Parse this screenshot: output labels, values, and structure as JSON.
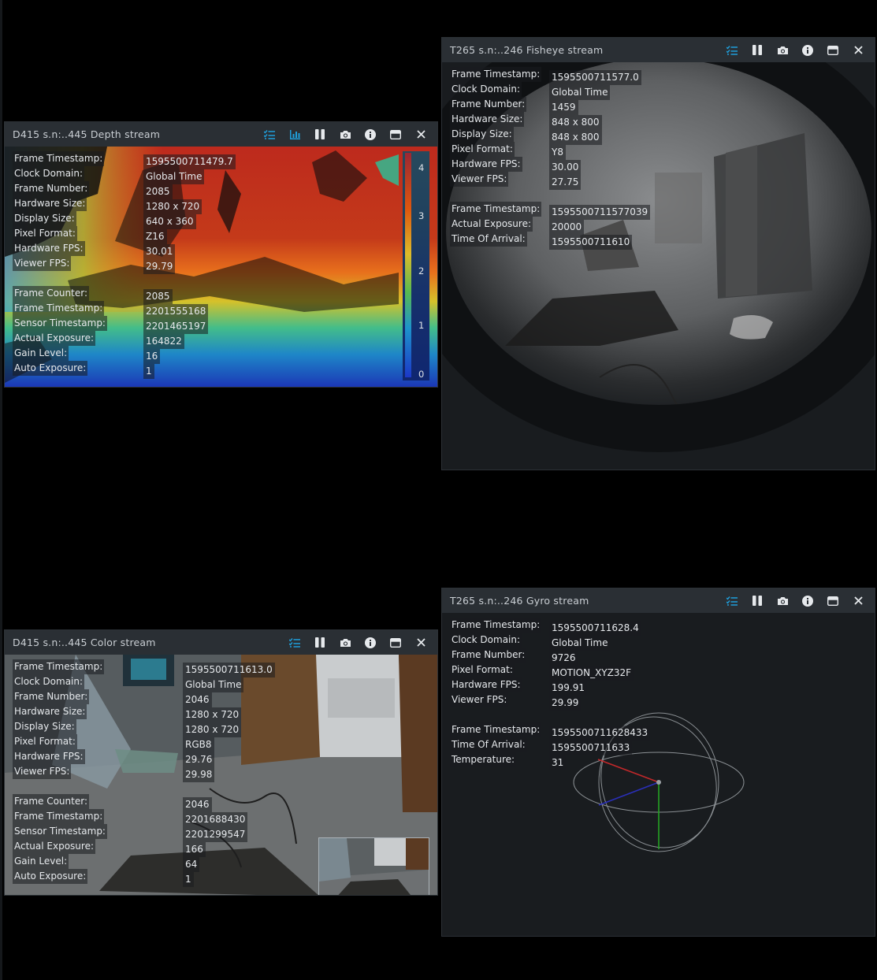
{
  "accent_color": "#1f9fdb",
  "depth": {
    "title": "D415 s.n:..445 Depth stream",
    "rows": [
      {
        "label": "Frame Timestamp:",
        "value": "1595500711479.7"
      },
      {
        "label": "Clock Domain:",
        "value": "Global Time"
      },
      {
        "label": "Frame Number:",
        "value": "2085"
      },
      {
        "label": "Hardware Size:",
        "value": "1280 x 720"
      },
      {
        "label": "Display Size:",
        "value": "640 x 360"
      },
      {
        "label": "Pixel Format:",
        "value": "Z16"
      },
      {
        "label": "Hardware FPS:",
        "value": "30.01"
      },
      {
        "label": "Viewer FPS:",
        "value": "29.79"
      }
    ],
    "rows2": [
      {
        "label": "Frame Counter:",
        "value": "2085"
      },
      {
        "label": "Frame Timestamp:",
        "value": "2201555168"
      },
      {
        "label": "Sensor Timestamp:",
        "value": "2201465197"
      },
      {
        "label": "Actual Exposure:",
        "value": "164822"
      },
      {
        "label": "Gain Level:",
        "value": "16"
      },
      {
        "label": "Auto Exposure:",
        "value": "1"
      }
    ],
    "scale_ticks": [
      "4",
      "3",
      "2",
      "1",
      "0"
    ]
  },
  "fisheye": {
    "title": "T265 s.n:..246 Fisheye stream",
    "rows": [
      {
        "label": "Frame Timestamp:",
        "value": "1595500711577.0"
      },
      {
        "label": "Clock Domain:",
        "value": "Global Time"
      },
      {
        "label": "Frame Number:",
        "value": "1459"
      },
      {
        "label": "Hardware Size:",
        "value": "848 x 800"
      },
      {
        "label": "Display Size:",
        "value": "848 x 800"
      },
      {
        "label": "Pixel Format:",
        "value": "Y8"
      },
      {
        "label": "Hardware FPS:",
        "value": "30.00"
      },
      {
        "label": "Viewer FPS:",
        "value": "27.75"
      }
    ],
    "rows2": [
      {
        "label": "Frame Timestamp:",
        "value": "1595500711577039"
      },
      {
        "label": "Actual Exposure:",
        "value": "20000"
      },
      {
        "label": "Time Of Arrival:",
        "value": "1595500711610"
      }
    ]
  },
  "color": {
    "title": "D415 s.n:..445 Color stream",
    "rows": [
      {
        "label": "Frame Timestamp:",
        "value": "1595500711613.0"
      },
      {
        "label": "Clock Domain:",
        "value": "Global Time"
      },
      {
        "label": "Frame Number:",
        "value": "2046"
      },
      {
        "label": "Hardware Size:",
        "value": "1280 x 720"
      },
      {
        "label": "Display Size:",
        "value": "1280 x 720"
      },
      {
        "label": "Pixel Format:",
        "value": "RGB8"
      },
      {
        "label": "Hardware FPS:",
        "value": "29.76"
      },
      {
        "label": "Viewer FPS:",
        "value": "29.98"
      }
    ],
    "rows2": [
      {
        "label": "Frame Counter:",
        "value": "2046"
      },
      {
        "label": "Frame Timestamp:",
        "value": "2201688430"
      },
      {
        "label": "Sensor Timestamp:",
        "value": "2201299547"
      },
      {
        "label": "Actual Exposure:",
        "value": "166"
      },
      {
        "label": "Gain Level:",
        "value": "64"
      },
      {
        "label": "Auto Exposure:",
        "value": "1"
      }
    ]
  },
  "gyro": {
    "title": "T265 s.n:..246 Gyro stream",
    "rows": [
      {
        "label": "Frame Timestamp:",
        "value": "1595500711628.4"
      },
      {
        "label": "Clock Domain:",
        "value": "Global Time"
      },
      {
        "label": "Frame Number:",
        "value": "9726"
      },
      {
        "label": "Pixel Format:",
        "value": "MOTION_XYZ32F"
      },
      {
        "label": "Hardware FPS:",
        "value": "199.91"
      },
      {
        "label": "Viewer FPS:",
        "value": "29.99"
      }
    ],
    "rows2": [
      {
        "label": "Frame Timestamp:",
        "value": "1595500711628433"
      },
      {
        "label": "Time Of Arrival:",
        "value": "1595500711633"
      },
      {
        "label": "Temperature:",
        "value": "31"
      }
    ]
  }
}
